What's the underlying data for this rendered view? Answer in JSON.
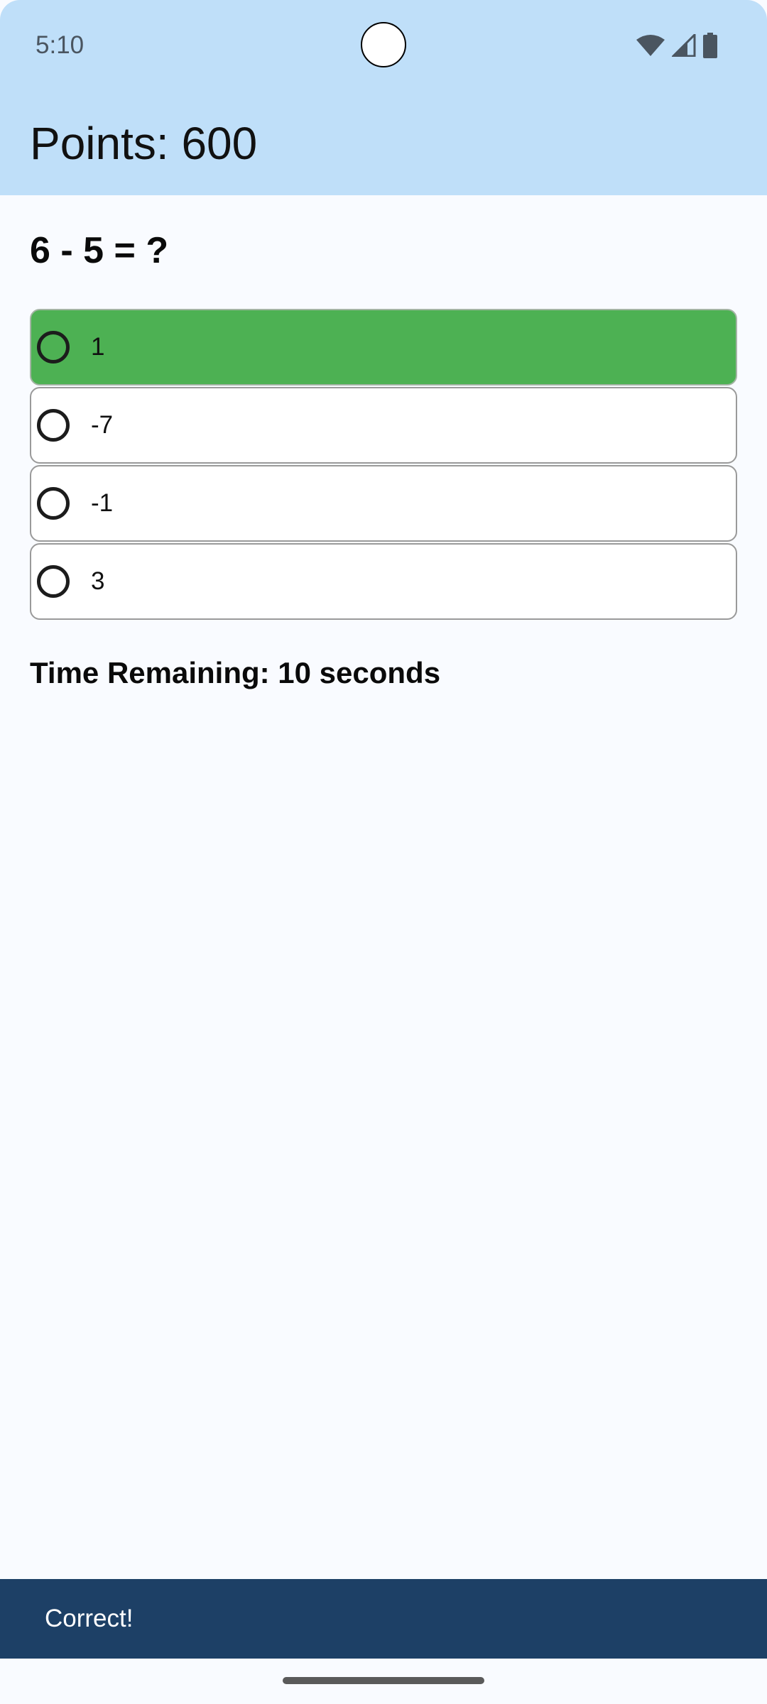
{
  "status_bar": {
    "time": "5:10",
    "icons": [
      "wifi-icon",
      "signal-icon",
      "battery-icon"
    ]
  },
  "header": {
    "title": "Points: 600",
    "background_color": "#bfdff9"
  },
  "quiz": {
    "question": "6 - 5 = ?",
    "options": [
      {
        "label": "1",
        "state": "correct"
      },
      {
        "label": "-7",
        "state": "default"
      },
      {
        "label": "-1",
        "state": "default"
      },
      {
        "label": "3",
        "state": "default"
      }
    ],
    "timer_text": "Time Remaining: 10 seconds",
    "correct_color": "#4db153"
  },
  "snackbar": {
    "message": "Correct!",
    "background_color": "#1d4066"
  }
}
